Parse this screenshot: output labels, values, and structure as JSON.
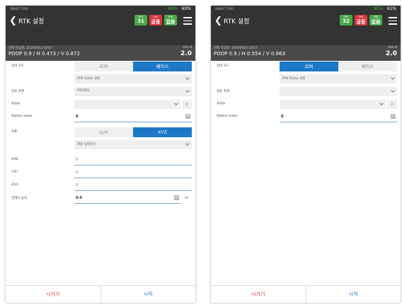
{
  "left": {
    "status": {
      "app": "SMART TOPO",
      "signal": "99%",
      "battery": "60%"
    },
    "header": {
      "title": "RTK 설정",
      "badges": [
        {
          "label": "GPS",
          "value": "31",
          "color": "#49a84a"
        },
        {
          "label": "VRS",
          "value": "공동",
          "color": "#d8373e"
        },
        {
          "label": "보정",
          "value": "없음",
          "color": "#49a84a"
        }
      ]
    },
    "info": {
      "job": "현재 작업명: 20190923-2003",
      "pdop": "PDOP 0.9 / H 0.473 / V 0.872",
      "ant_label": "Ant.H",
      "ant_value": "2.0"
    },
    "form": {
      "mode_label": "장비 모드",
      "mode_rover": "로버",
      "mode_base": "베이스",
      "radio_select": "RTK Radio 설정",
      "format_label": "방송 포맷",
      "format_value": "RTCM21",
      "freq_label": "주파수",
      "freq_value": "",
      "station_label": "Station Index",
      "station_value": "0",
      "coord_label": "좌표",
      "coord_llh": "LLH",
      "coord_xyz": "XYZ",
      "coord_select": "좌표 입력하기",
      "x_label": "X(N)",
      "x_value": "0",
      "y_label": "Y(E)",
      "y_value": "0",
      "z_label": "Z(H)",
      "z_value": "0",
      "ant_label": "안테나 높이",
      "ant_value": "0.0",
      "ant_unit": "m"
    },
    "bottom": {
      "back": "나가기",
      "start": "시작"
    }
  },
  "right": {
    "status": {
      "app": "SMART TOPO",
      "signal": "95%",
      "battery": "61%"
    },
    "header": {
      "title": "RTK 설정",
      "badges": [
        {
          "label": "GPS",
          "value": "32",
          "color": "#49a84a"
        },
        {
          "label": "VRS",
          "value": "공동",
          "color": "#d8373e"
        },
        {
          "label": "보정",
          "value": "없음",
          "color": "#49a84a"
        }
      ]
    },
    "info": {
      "job": "현재 작업명: 20190923-2003",
      "pdop": "PDOP 0.9 / H 0.554 / V 0.963",
      "ant_label": "Ant.H",
      "ant_value": "2.0"
    },
    "form": {
      "mode_label": "장비 모드",
      "mode_rover": "로버",
      "mode_base": "베이스",
      "radio_select": "RTK Radio 설정",
      "format_label": "방송 포맷",
      "format_value": "",
      "freq_label": "주파수",
      "freq_value": "",
      "station_label": "Station Index",
      "station_value": "0"
    },
    "bottom": {
      "back": "나가기",
      "start": "시작"
    }
  }
}
